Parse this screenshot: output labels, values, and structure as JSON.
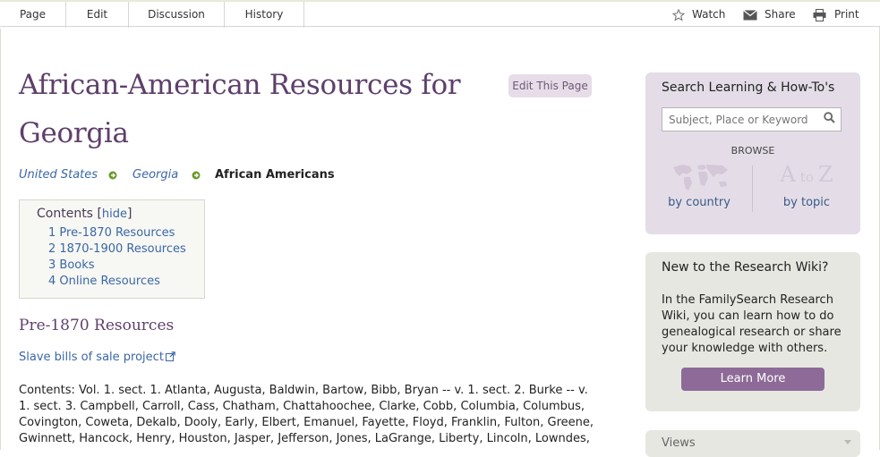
{
  "tabs": [
    {
      "label": "Page",
      "active": true
    },
    {
      "label": "Edit",
      "active": false
    },
    {
      "label": "Discussion",
      "active": false
    },
    {
      "label": "History",
      "active": false
    }
  ],
  "actions": {
    "watch": "Watch",
    "share": "Share",
    "print": "Print"
  },
  "page": {
    "title_line1": "African-American Resources for",
    "title_line2": "Georgia",
    "edit_button": "Edit This Page"
  },
  "breadcrumb": {
    "items": [
      "United States",
      "Georgia"
    ],
    "current": "African Americans"
  },
  "toc": {
    "heading": "Contents",
    "hide_open": "[",
    "hide": "hide",
    "hide_close": "]",
    "items": [
      "1 Pre-1870 Resources",
      "2 1870-1900 Resources",
      "3 Books",
      "4 Online Resources"
    ]
  },
  "section": {
    "heading": "Pre-1870 Resources",
    "link": "Slave bills of sale project",
    "contents": "Contents: Vol. 1. sect. 1. Atlanta, Augusta, Baldwin, Bartow, Bibb, Bryan -- v. 1. sect. 2. Burke -- v. 1. sect. 3. Campbell, Carroll, Cass, Chatham, Chattahoochee, Clarke, Cobb, Columbia, Columbus, Covington, Coweta, Dekalb, Dooly, Early, Elbert, Emanuel, Fayette, Floyd, Franklin, Fulton, Greene, Gwinnett, Hancock, Henry, Houston, Jasper, Jefferson, Jones, LaGrange, Liberty, Lincoln, Lowndes,"
  },
  "sidebar": {
    "search": {
      "title": "Search Learning & How-To's",
      "placeholder": "Subject, Place or Keyword",
      "browse": "BROWSE",
      "by_country": "by country",
      "by_topic": "by topic",
      "atoz_a": "A",
      "atoz_to": "to",
      "atoz_z": "Z"
    },
    "new": {
      "title": "New to the Research Wiki?",
      "body": "In the FamilySearch Research Wiki, you can learn how to do genealogical research or share your knowledge with others.",
      "button": "Learn More"
    },
    "views": {
      "title": "Views"
    }
  },
  "colors": {
    "title": "#5e3f6b",
    "link": "#3a67a6",
    "search_panel_bg": "#e4dde7",
    "info_panel_bg": "#e6e7e1",
    "button_bg": "#8d6a97"
  }
}
